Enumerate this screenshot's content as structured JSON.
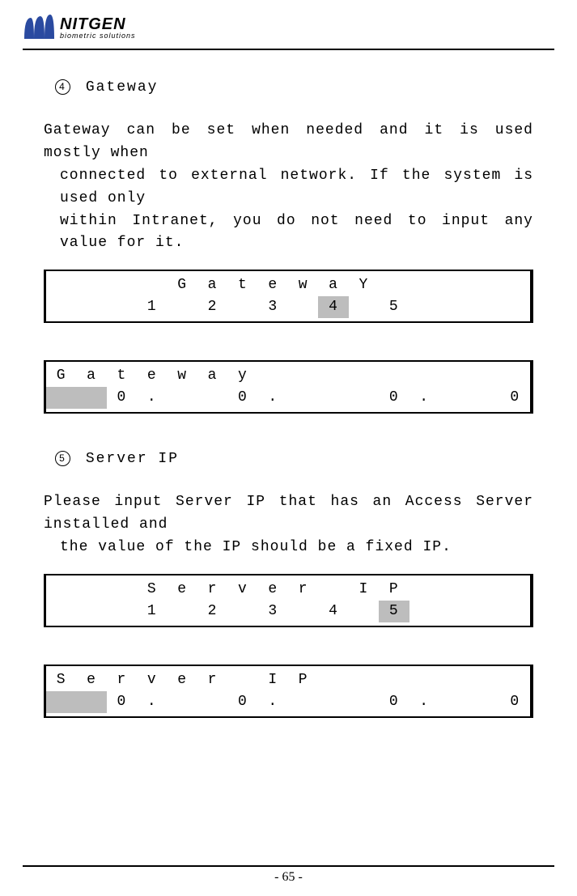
{
  "brand": {
    "name": "NITGEN",
    "sub": "biometric solutions"
  },
  "sec4": {
    "num": "4",
    "title": "Gateway",
    "para_l1": "Gateway can be set when needed and it is used mostly when",
    "para_l2": "connected to external network. If the system is used only",
    "para_l3": "within Intranet, you do not need to input any value for it.",
    "lcd1": {
      "r1": [
        "",
        "",
        "",
        "",
        "G",
        "a",
        "t",
        "e",
        "w",
        "a",
        "Y",
        "",
        "",
        "",
        "",
        ""
      ],
      "r2": [
        "",
        "",
        "",
        "1",
        "",
        "2",
        "",
        "3",
        "",
        "4",
        "",
        "5",
        "",
        "",
        "",
        ""
      ],
      "hl_r2_idx": 9
    },
    "lcd2": {
      "r1": [
        "G",
        "a",
        "t",
        "e",
        "w",
        "a",
        "y",
        "",
        "",
        "",
        "",
        "",
        "",
        "",
        "",
        ""
      ],
      "r2": [
        "",
        "",
        "0",
        ".",
        "",
        "",
        "0",
        ".",
        "",
        "",
        "",
        "0",
        ".",
        "",
        "",
        "0"
      ],
      "hl_r2_range": [
        0,
        1
      ]
    }
  },
  "sec5": {
    "num": "5",
    "title": "Server IP",
    "para_l1": "Please input Server IP that has an Access Server installed and",
    "para_l2": "the value of the IP should be a fixed IP.",
    "lcd1": {
      "r1": [
        "",
        "",
        "",
        "S",
        "e",
        "r",
        "v",
        "e",
        "r",
        "",
        "I",
        "P",
        "",
        "",
        "",
        ""
      ],
      "r2": [
        "",
        "",
        "",
        "1",
        "",
        "2",
        "",
        "3",
        "",
        "4",
        "",
        "5",
        "",
        "",
        "",
        ""
      ],
      "hl_r2_idx": 11
    },
    "lcd2": {
      "r1": [
        "S",
        "e",
        "r",
        "v",
        "e",
        "r",
        "",
        "I",
        "P",
        "",
        "",
        "",
        "",
        "",
        "",
        ""
      ],
      "r2": [
        "",
        "",
        "0",
        ".",
        "",
        "",
        "0",
        ".",
        "",
        "",
        "",
        "0",
        ".",
        "",
        "",
        "0"
      ],
      "hl_r2_range": [
        0,
        1
      ]
    }
  },
  "page_num": "- 65 -"
}
